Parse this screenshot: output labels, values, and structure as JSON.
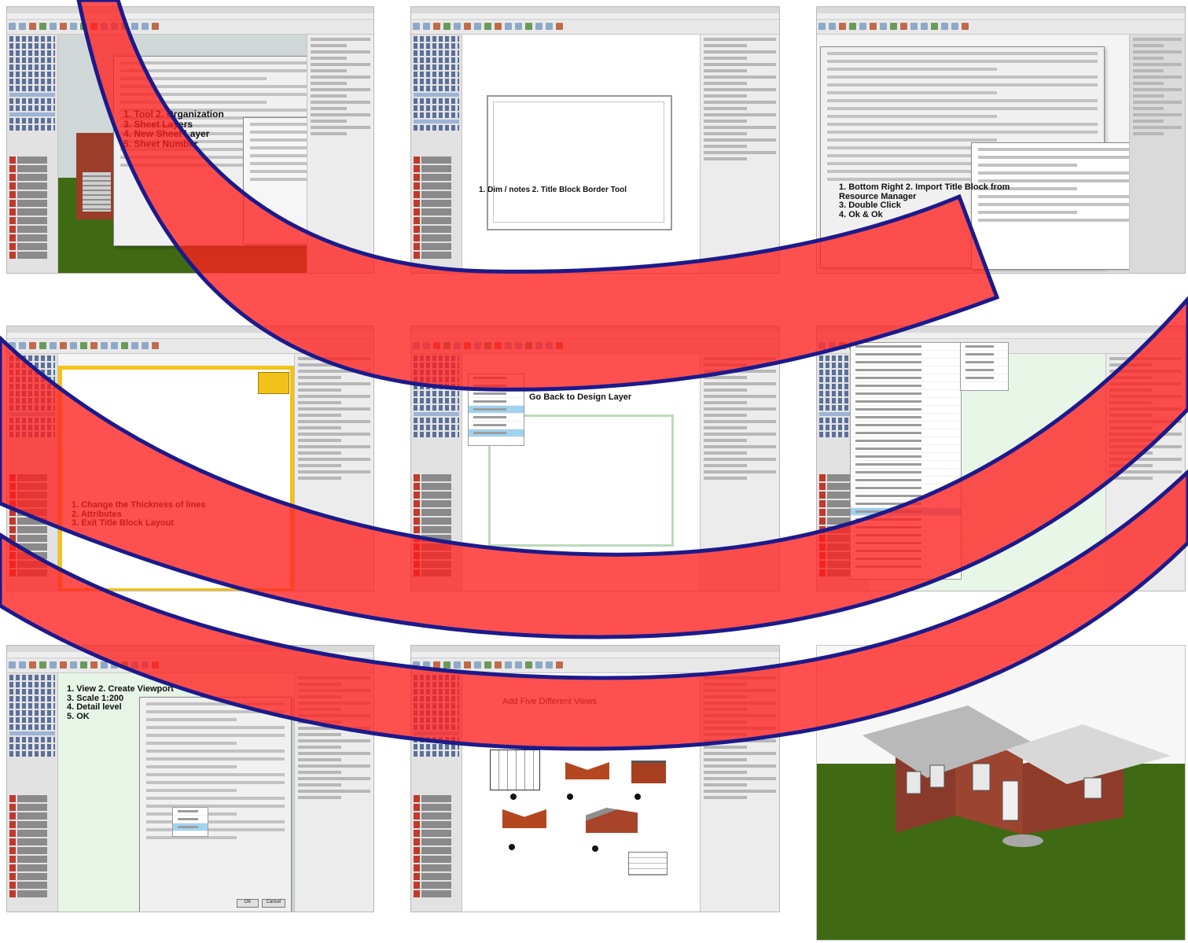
{
  "panels": [
    {
      "id": "p1",
      "caption": "1. Tool 2. Organization\n3. Sheet Layers\n4. New Sheet Layer\n5. Sheet Number"
    },
    {
      "id": "p2",
      "caption": "1. Dim / notes 2. Title Block Border Tool"
    },
    {
      "id": "p3",
      "caption": "1. Bottom Right 2. Import Title Block from\nResource Manager\n3. Double Click\n4. Ok & Ok"
    },
    {
      "id": "p4",
      "caption": "1. Change the Thickness of lines\n2. Attributes\n3. Exit Title Block Layout"
    },
    {
      "id": "p5",
      "caption": "Go Back to Design Layer"
    },
    {
      "id": "p6",
      "caption": ""
    },
    {
      "id": "p7",
      "caption": "1. View 2. Create Viewport\n3. Scale 1:200\n4. Detail level\n5. OK"
    },
    {
      "id": "p8",
      "caption": "Add Five Different Views"
    }
  ],
  "colors": {
    "arc_fill": "#ff1f1f",
    "arc_stroke": "#1c1a8a",
    "grass": "#3f6a13",
    "brick": "#8a3a2a",
    "roof": "#b9b9b9"
  },
  "icons": {
    "dialog_ok": "OK",
    "dialog_cancel": "Cancel"
  }
}
